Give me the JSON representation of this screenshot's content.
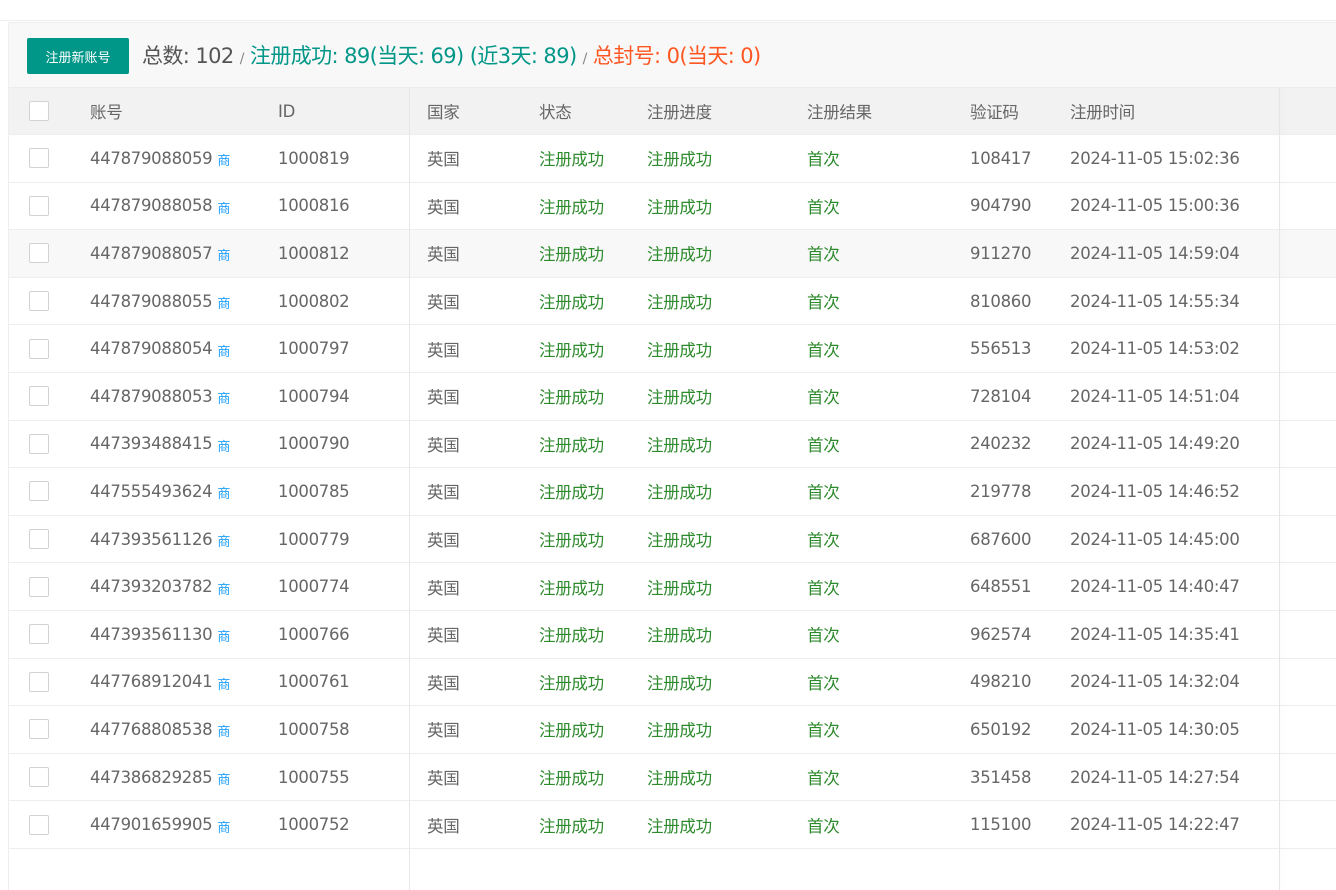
{
  "toolbar": {
    "register_button": "注册新账号",
    "total": "总数: 102",
    "sep1": "/",
    "success": "注册成功: 89(当天: 69) (近3天: 89)",
    "sep2": "/",
    "banned": "总封号: 0(当天: 0)"
  },
  "table": {
    "headers": {
      "account": "账号",
      "id": "ID",
      "country": "国家",
      "status": "状态",
      "progress": "注册进度",
      "result": "注册结果",
      "code": "验证码",
      "time": "注册时间"
    },
    "rows": [
      {
        "account": "447879088059",
        "tag": "商",
        "id": "1000819",
        "country": "英国",
        "status": "注册成功",
        "progress": "注册成功",
        "result": "首次",
        "code": "108417",
        "time": "2024-11-05 15:02:36"
      },
      {
        "account": "447879088058",
        "tag": "商",
        "id": "1000816",
        "country": "英国",
        "status": "注册成功",
        "progress": "注册成功",
        "result": "首次",
        "code": "904790",
        "time": "2024-11-05 15:00:36"
      },
      {
        "account": "447879088057",
        "tag": "商",
        "id": "1000812",
        "country": "英国",
        "status": "注册成功",
        "progress": "注册成功",
        "result": "首次",
        "code": "911270",
        "time": "2024-11-05 14:59:04"
      },
      {
        "account": "447879088055",
        "tag": "商",
        "id": "1000802",
        "country": "英国",
        "status": "注册成功",
        "progress": "注册成功",
        "result": "首次",
        "code": "810860",
        "time": "2024-11-05 14:55:34"
      },
      {
        "account": "447879088054",
        "tag": "商",
        "id": "1000797",
        "country": "英国",
        "status": "注册成功",
        "progress": "注册成功",
        "result": "首次",
        "code": "556513",
        "time": "2024-11-05 14:53:02"
      },
      {
        "account": "447879088053",
        "tag": "商",
        "id": "1000794",
        "country": "英国",
        "status": "注册成功",
        "progress": "注册成功",
        "result": "首次",
        "code": "728104",
        "time": "2024-11-05 14:51:04"
      },
      {
        "account": "447393488415",
        "tag": "商",
        "id": "1000790",
        "country": "英国",
        "status": "注册成功",
        "progress": "注册成功",
        "result": "首次",
        "code": "240232",
        "time": "2024-11-05 14:49:20"
      },
      {
        "account": "447555493624",
        "tag": "商",
        "id": "1000785",
        "country": "英国",
        "status": "注册成功",
        "progress": "注册成功",
        "result": "首次",
        "code": "219778",
        "time": "2024-11-05 14:46:52"
      },
      {
        "account": "447393561126",
        "tag": "商",
        "id": "1000779",
        "country": "英国",
        "status": "注册成功",
        "progress": "注册成功",
        "result": "首次",
        "code": "687600",
        "time": "2024-11-05 14:45:00"
      },
      {
        "account": "447393203782",
        "tag": "商",
        "id": "1000774",
        "country": "英国",
        "status": "注册成功",
        "progress": "注册成功",
        "result": "首次",
        "code": "648551",
        "time": "2024-11-05 14:40:47"
      },
      {
        "account": "447393561130",
        "tag": "商",
        "id": "1000766",
        "country": "英国",
        "status": "注册成功",
        "progress": "注册成功",
        "result": "首次",
        "code": "962574",
        "time": "2024-11-05 14:35:41"
      },
      {
        "account": "447768912041",
        "tag": "商",
        "id": "1000761",
        "country": "英国",
        "status": "注册成功",
        "progress": "注册成功",
        "result": "首次",
        "code": "498210",
        "time": "2024-11-05 14:32:04"
      },
      {
        "account": "447768808538",
        "tag": "商",
        "id": "1000758",
        "country": "英国",
        "status": "注册成功",
        "progress": "注册成功",
        "result": "首次",
        "code": "650192",
        "time": "2024-11-05 14:30:05"
      },
      {
        "account": "447386829285",
        "tag": "商",
        "id": "1000755",
        "country": "英国",
        "status": "注册成功",
        "progress": "注册成功",
        "result": "首次",
        "code": "351458",
        "time": "2024-11-05 14:27:54"
      },
      {
        "account": "447901659905",
        "tag": "商",
        "id": "1000752",
        "country": "英国",
        "status": "注册成功",
        "progress": "注册成功",
        "result": "首次",
        "code": "115100",
        "time": "2024-11-05 14:22:47"
      }
    ]
  },
  "colors": {
    "accent": "#009688",
    "success_text": "#2d8a2d",
    "danger": "#ff5722",
    "tag": "#1e9fff"
  }
}
